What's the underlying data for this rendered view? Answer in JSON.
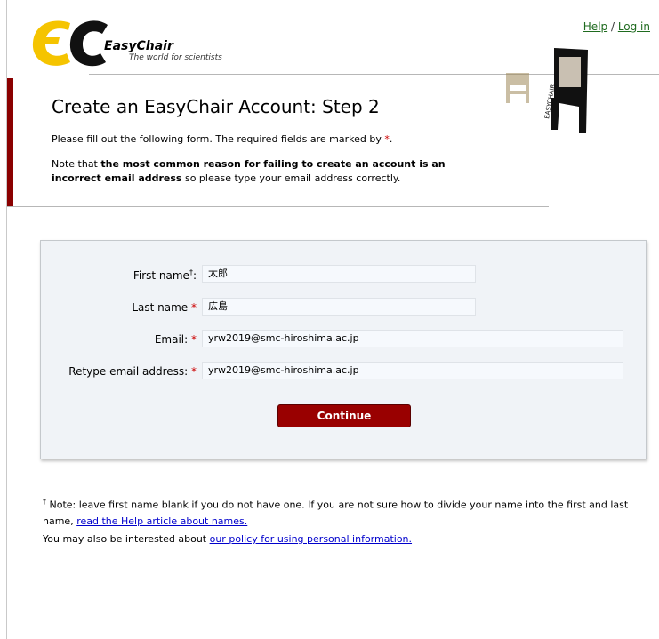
{
  "header": {
    "brand": "EasyChair",
    "tagline": "The world for scientists",
    "help_link": "Help",
    "separator": " / ",
    "login_link": "Log in",
    "chair_text": "EASYCHAIR"
  },
  "page": {
    "title": "Create an EasyChair Account: Step 2",
    "intro_text": "Please fill out the following form. The required fields are marked by ",
    "required_marker": "*",
    "intro_end": ".",
    "note_prefix": "Note that ",
    "note_bold": "the most common reason for failing to create an account is an incorrect email address",
    "note_suffix": " so please type your email address correctly."
  },
  "form": {
    "first_name_label": "First name",
    "first_name_sup": "†",
    "first_name_colon": ":",
    "first_name_value": "太郎",
    "last_name_label": "Last name",
    "last_name_value": "広島",
    "email_label": "Email:",
    "email_value": "yrw2019@smc-hiroshima.ac.jp",
    "retype_email_label": "Retype email address:",
    "retype_email_value": "yrw2019@smc-hiroshima.ac.jp",
    "required_marker": "*",
    "submit_label": "Continue"
  },
  "footnote": {
    "dagger": "†",
    "text": " Note: leave first name blank if you do not have one. If you are not sure how to divide your name into the first and last name, ",
    "help_link": "read the Help article about names.",
    "policy_prefix": "You may also be interested about ",
    "policy_link": "our policy for using personal information."
  },
  "colors": {
    "accent_red": "#990000",
    "link_green": "#1f6b1f",
    "link_blue": "#0000cc",
    "logo_yellow": "#f5c400"
  }
}
